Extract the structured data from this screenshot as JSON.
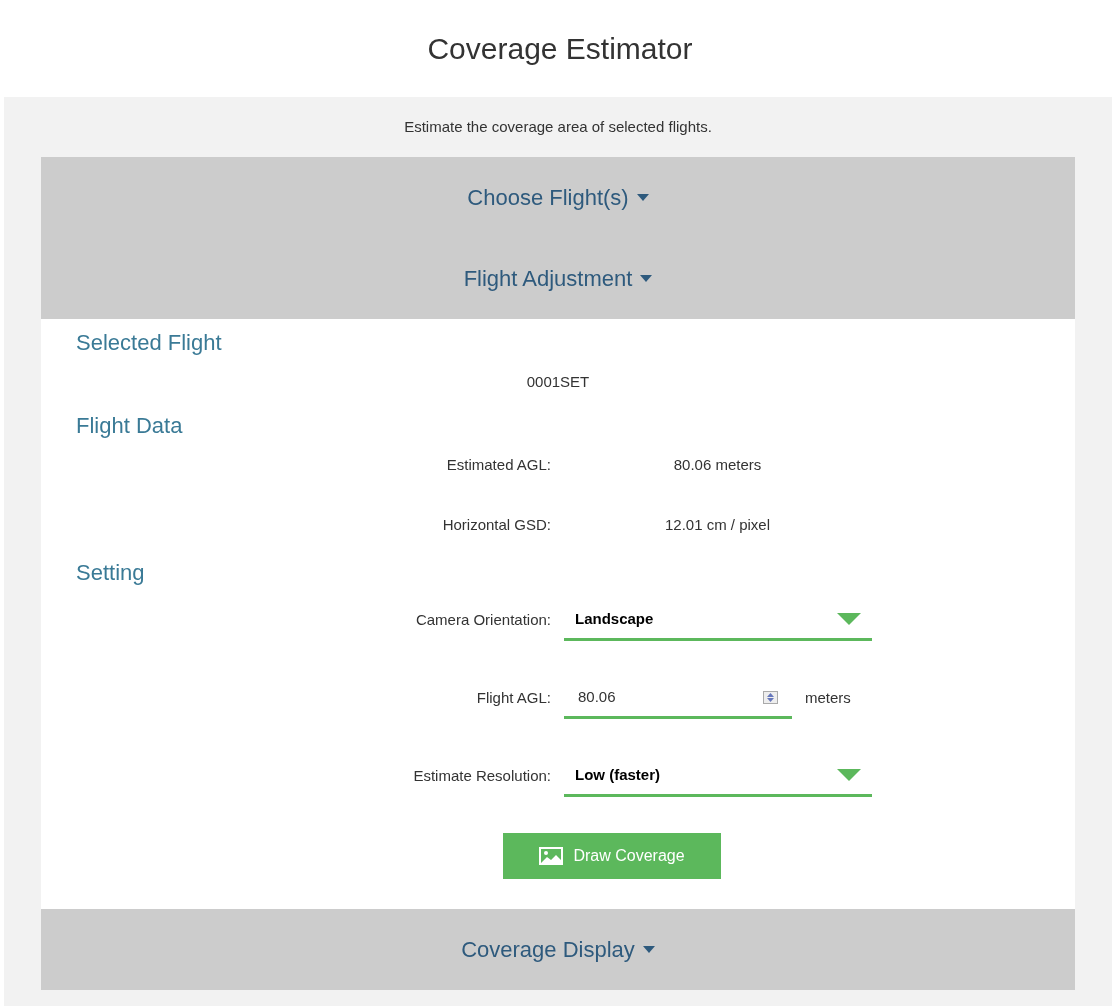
{
  "page_title": "Coverage Estimator",
  "description": "Estimate the coverage area of selected flights.",
  "sections": [
    {
      "title": "Choose Flight(s)"
    },
    {
      "title": "Flight Adjustment",
      "content": {
        "selected_flight": {
          "heading": "Selected Flight",
          "value": "0001SET"
        },
        "flight_data": {
          "heading": "Flight Data",
          "rows": [
            {
              "label": "Estimated AGL:",
              "value": "80.06 meters"
            },
            {
              "label": "Horizontal GSD:",
              "value": "12.01 cm / pixel"
            }
          ]
        },
        "setting": {
          "heading": "Setting",
          "fields": [
            {
              "kind": "select",
              "label": "Camera Orientation:",
              "value": "Landscape"
            },
            {
              "kind": "number",
              "label": "Flight AGL:",
              "value": "80.06",
              "unit": "meters"
            },
            {
              "kind": "select",
              "label": "Estimate Resolution:",
              "value": "Low (faster)"
            }
          ]
        },
        "button": {
          "label": "Draw Coverage"
        }
      }
    },
    {
      "title": "Coverage Display"
    }
  ]
}
